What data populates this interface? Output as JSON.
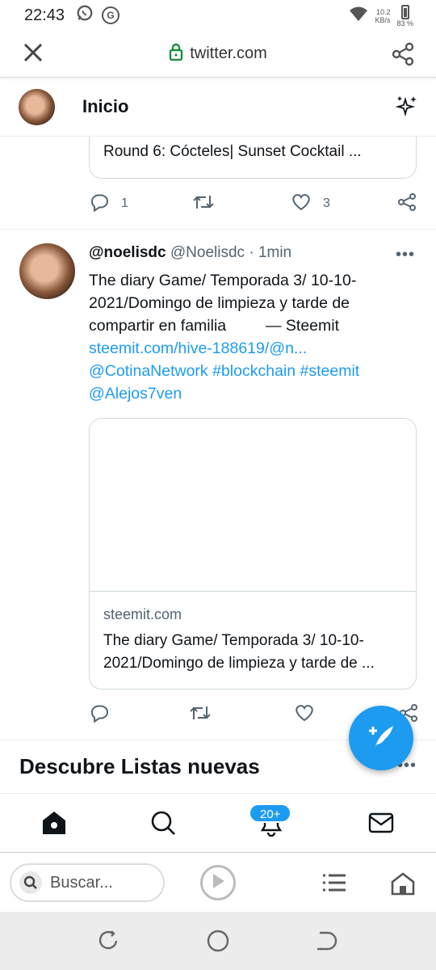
{
  "status_bar": {
    "time": "22:43",
    "net_speed_value": "10.2",
    "net_speed_unit": "KB/s",
    "battery": "83 %"
  },
  "browser": {
    "url": "twitter.com"
  },
  "header": {
    "title": "Inicio"
  },
  "prev_tweet": {
    "card_title": "Round 6: Cócteles| Sunset Cocktail ...",
    "replies": "1",
    "likes": "3"
  },
  "tweet": {
    "display_name": "@noelisdc",
    "handle": "@Noelisdc",
    "separator": "·",
    "time": "1min",
    "text_line1": "The diary Game/ Temporada 3/ 10-10-",
    "text_line2": "2021/Domingo de limpieza y tarde de",
    "text_line3": "compartir en familia",
    "text_line3_suffix": "— Steemit",
    "link1": "steemit.com/hive-188619/@n...",
    "mention1": "@CotinaNetwork",
    "hashtag1": "#blockchain",
    "hashtag2": "#steemit",
    "mention2": "@Alejos7ven",
    "card_domain": "steemit.com",
    "card_title_1": "The diary Game/ Temporada 3/ 10-10-",
    "card_title_2": "2021/Domingo de limpieza y tarde de ..."
  },
  "discover": {
    "title": "Descubre Listas nuevas"
  },
  "nav": {
    "notifications_badge": "20+"
  },
  "browser_bottom": {
    "search_placeholder": "Buscar..."
  },
  "colors": {
    "accent": "#1d9bf0",
    "text": "#0f1419",
    "muted": "#536471"
  }
}
